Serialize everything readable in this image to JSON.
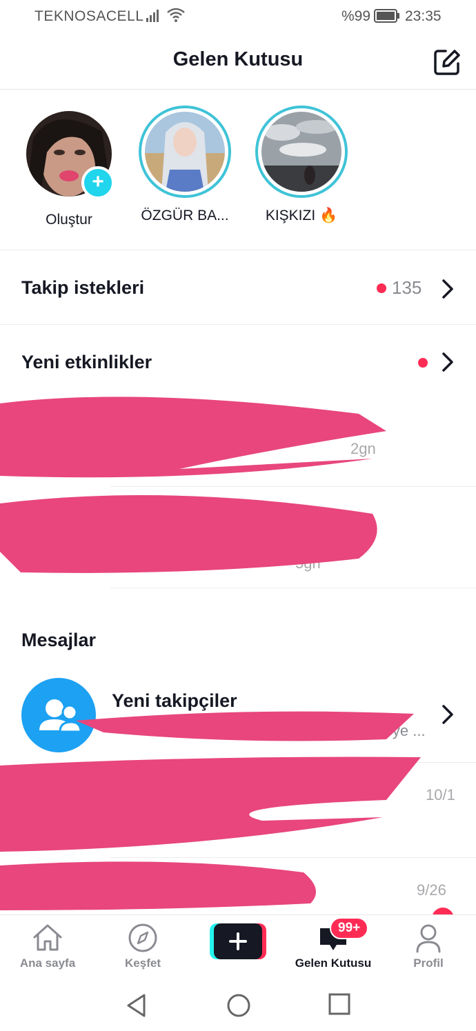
{
  "status": {
    "carrier": "TEKNOSACELL",
    "battery": "%99",
    "time": "23:35"
  },
  "header": {
    "title": "Gelen Kutusu"
  },
  "stories": [
    {
      "label": "Oluştur"
    },
    {
      "label": "ÖZGÜR BA..."
    },
    {
      "label": "KIŞKIZI 🔥"
    }
  ],
  "follow_requests": {
    "title": "Takip istekleri",
    "count": "135"
  },
  "activities": {
    "title": "Yeni etkinlikler",
    "items": [
      {
        "meta": "2gn"
      },
      {
        "meta": "5gn"
      }
    ]
  },
  "messages": {
    "title": "Mesajlar",
    "new_followers": {
      "title": "Yeni takipçiler",
      "subtitle": "etmeye ..."
    },
    "dates": [
      "10/1",
      "9/26"
    ]
  },
  "nav": {
    "home": "Ana sayfa",
    "discover": "Keşfet",
    "inbox": "Gelen Kutusu",
    "profile": "Profil",
    "badge": "99+"
  }
}
